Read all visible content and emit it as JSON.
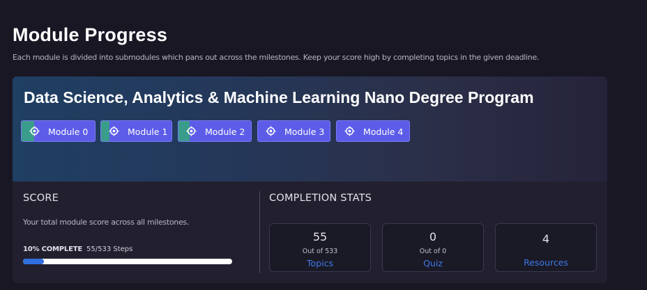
{
  "page": {
    "title": "Module Progress",
    "subtitle": "Each module is divided into submodules which pans out across the milestones. Keep your score high by completing topics in the given deadline."
  },
  "program": {
    "title": "Data Science, Analytics & Machine Learning Nano Degree Program",
    "modules": [
      {
        "label": "Module 0",
        "icon": "target-icon",
        "progress": 0.17
      },
      {
        "label": "Module 1",
        "icon": "target-icon",
        "progress": 0.12
      },
      {
        "label": "Module 2",
        "icon": "target-icon",
        "progress": 0.15
      },
      {
        "label": "Module 3",
        "icon": "target-icon",
        "progress": 0
      },
      {
        "label": "Module 4",
        "icon": "target-icon",
        "progress": 0
      }
    ]
  },
  "score": {
    "heading": "SCORE",
    "description": "Your total module score across all milestones.",
    "percent_label": "10% COMPLETE",
    "steps_label": "55/533 Steps",
    "progress": 0.1
  },
  "stats": {
    "heading": "COMPLETION STATS",
    "items": [
      {
        "value": "55",
        "sub": "Out of 533",
        "link": "Topics"
      },
      {
        "value": "0",
        "sub": "Out of 0",
        "link": "Quiz"
      },
      {
        "value": "4",
        "sub": "",
        "link": "Resources"
      }
    ]
  },
  "colors": {
    "background": "#191724",
    "chip": "#5c5ce9",
    "chip_progress": "#3a9c8a",
    "link": "#3e7ae6",
    "progress_bar": "#2f6fe0"
  }
}
